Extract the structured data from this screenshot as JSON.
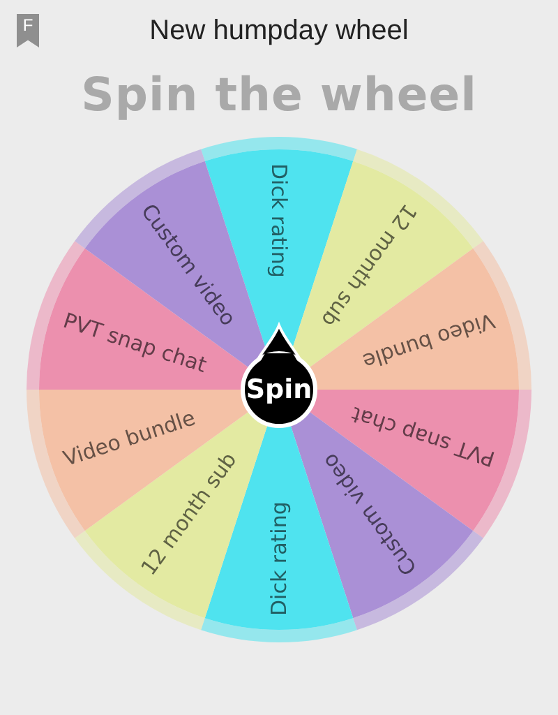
{
  "header": {
    "app_icon_letter": "F",
    "title": "New humpday wheel"
  },
  "heading": "Spin the wheel",
  "wheel": {
    "segments": [
      {
        "label": "Dick rating",
        "color": "#4fe3ef"
      },
      {
        "label": "12 month sub",
        "color": "#e3eaa2"
      },
      {
        "label": "Video bundle",
        "color": "#f4c1a6"
      },
      {
        "label": "PVT snap chat",
        "color": "#ec90ae"
      },
      {
        "label": "Custom video",
        "color": "#aa90d6"
      },
      {
        "label": "Dick rating",
        "color": "#4fe3ef"
      },
      {
        "label": "12 month sub",
        "color": "#e3eaa2"
      },
      {
        "label": "Video bundle",
        "color": "#f4c1a6"
      },
      {
        "label": "PVT snap chat",
        "color": "#ec90ae"
      },
      {
        "label": "Custom video",
        "color": "#aa90d6"
      }
    ],
    "spin_button": "Spin"
  }
}
